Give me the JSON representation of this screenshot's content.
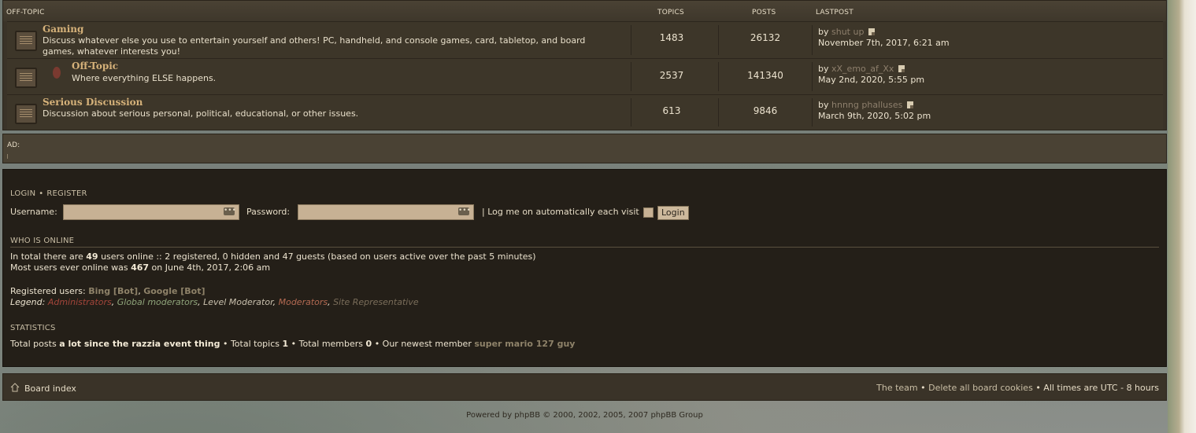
{
  "forum": {
    "headers": {
      "section": "OFF-TOPIC",
      "topics": "TOPICS",
      "posts": "POSTS",
      "lastpost": "LASTPOST"
    },
    "rows": [
      {
        "name": "Gaming",
        "description": "Discuss whatever else you use to entertain yourself and others! PC, handheld, and console games, card, tabletop, and board games, whatever interests you!",
        "topics": "1483",
        "posts": "26132",
        "last_by": "by",
        "last_user": "shut up",
        "last_date": "November 7th, 2017, 6:21 am"
      },
      {
        "name": "Off-Topic",
        "description": "Where everything ELSE happens.",
        "topics": "2537",
        "posts": "141340",
        "last_by": "by",
        "last_user": "xX_emo_af_Xx",
        "last_date": "May 2nd, 2020, 5:55 pm"
      },
      {
        "name": "Serious Discussion",
        "description": "Discussion about serious personal, political, educational, or other issues.",
        "topics": "613",
        "posts": "9846",
        "last_by": "by",
        "last_user": "hnnng phalluses",
        "last_date": "March 9th, 2020, 5:02 pm"
      }
    ]
  },
  "ad": {
    "label": "AD:"
  },
  "login": {
    "login_link": "LOGIN",
    "dot": "•",
    "register_link": "REGISTER",
    "username_label": "Username:",
    "password_label": "Password:",
    "auto_label": "| Log me on automatically each visit",
    "button": "Login"
  },
  "online": {
    "heading": "WHO IS ONLINE",
    "line1_prefix": "In total there are",
    "line1_count": "49",
    "line1_suffix": "users online :: 2 registered, 0 hidden and 47 guests (based on users active over the past 5 minutes)",
    "line2_prefix": "Most users ever online was",
    "line2_count": "467",
    "line2_suffix": "on June 4th, 2017, 2:06 am",
    "registered_label": "Registered users:",
    "bot1": "Bing [Bot]",
    "comma": ",",
    "bot2": "Google [Bot]",
    "legend_label": "Legend:",
    "legend": {
      "admin": "Administrators",
      "gmod": "Global moderators",
      "level": "Level Moderator",
      "mod": "Moderators",
      "site": "Site Representative"
    }
  },
  "stats": {
    "heading": "STATISTICS",
    "posts_label": "Total posts",
    "posts_value": "a lot since the razzia event thing",
    "topics_label": "• Total topics",
    "topics_value": "1",
    "members_label": "• Total members",
    "members_value": "0",
    "newest_label": "• Our newest member",
    "newest_value": "super mario 127 guy"
  },
  "footer": {
    "board_index": "Board index",
    "team": "The team",
    "bullet": "•",
    "delete_cookies": "Delete all board cookies",
    "times": "• All times are UTC - 8 hours",
    "powered": "Powered by phpBB © 2000, 2002, 2005, 2007 phpBB Group"
  }
}
